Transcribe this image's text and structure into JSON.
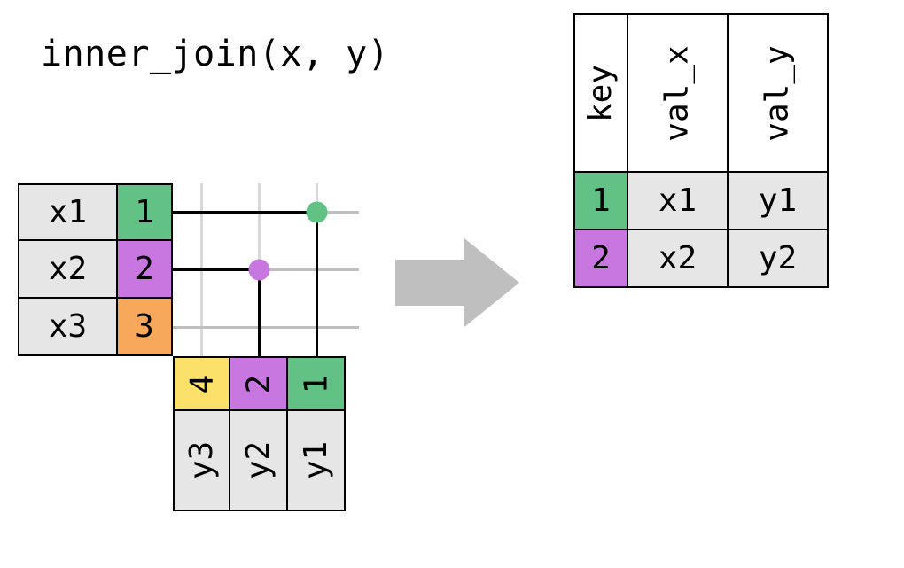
{
  "title": "inner_join(x, y)",
  "colors": {
    "grey": "#e6e6e6",
    "green": "#62c286",
    "purple": "#c977e0",
    "orange": "#f7a85a",
    "yellow": "#fbe069"
  },
  "x_table": {
    "rows": [
      {
        "val": "x1",
        "key": "1",
        "key_color": "green"
      },
      {
        "val": "x2",
        "key": "2",
        "key_color": "purple"
      },
      {
        "val": "x3",
        "key": "3",
        "key_color": "orange"
      }
    ]
  },
  "y_table": {
    "cols": [
      {
        "key": "4",
        "key_color": "yellow",
        "val": "y3"
      },
      {
        "key": "2",
        "key_color": "purple",
        "val": "y2"
      },
      {
        "key": "1",
        "key_color": "green",
        "val": "y1"
      }
    ]
  },
  "matches": [
    {
      "x_key": "1",
      "y_key": "1",
      "color": "green"
    },
    {
      "x_key": "2",
      "y_key": "2",
      "color": "purple"
    }
  ],
  "result": {
    "headers": {
      "key": "key",
      "val_x": "val_x",
      "val_y": "val_y"
    },
    "rows": [
      {
        "key": "1",
        "key_color": "green",
        "val_x": "x1",
        "val_y": "y1"
      },
      {
        "key": "2",
        "key_color": "purple",
        "val_x": "x2",
        "val_y": "y2"
      }
    ]
  }
}
